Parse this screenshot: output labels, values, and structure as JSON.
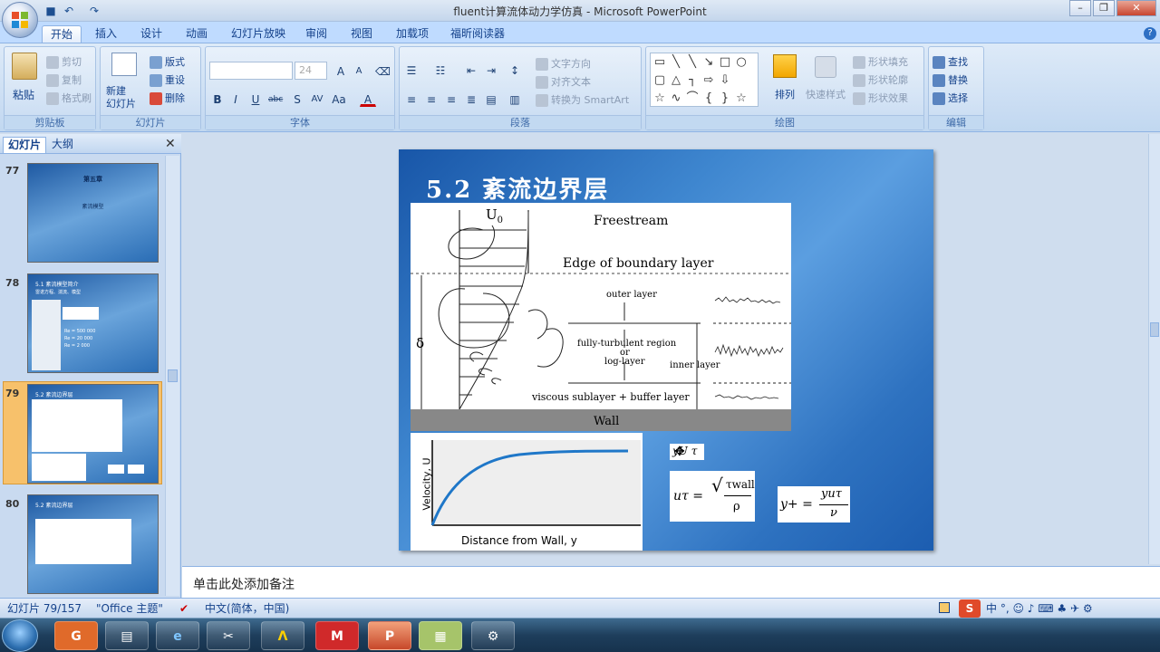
{
  "window": {
    "title": "fluent计算流体动力学仿真 - Microsoft PowerPoint"
  },
  "quick_access": [
    "save-icon",
    "undo-icon",
    "redo-icon"
  ],
  "tabs": [
    "开始",
    "插入",
    "设计",
    "动画",
    "幻灯片放映",
    "审阅",
    "视图",
    "加载项",
    "福昕阅读器"
  ],
  "ribbon": {
    "clipboard": {
      "paste": "粘贴",
      "cut": "剪切",
      "copy": "复制",
      "format_painter": "格式刷",
      "label": "剪贴板"
    },
    "slides": {
      "new_slide": "新建\n幻灯片",
      "layout": "版式",
      "reset": "重设",
      "delete": "删除",
      "label": "幻灯片"
    },
    "font": {
      "size": "24",
      "label": "字体"
    },
    "paragraph": {
      "text_direction": "文字方向",
      "align_text": "对齐文本",
      "convert_smartart": "转换为 SmartArt",
      "label": "段落"
    },
    "drawing": {
      "arrange": "排列",
      "quick_styles": "快速样式",
      "shape_fill": "形状填充",
      "shape_outline": "形状轮廓",
      "shape_effects": "形状效果",
      "label": "绘图"
    },
    "editing": {
      "find": "查找",
      "replace": "替换",
      "select": "选择",
      "label": "编辑"
    }
  },
  "pane_tabs": {
    "slides": "幻灯片",
    "outline": "大纲"
  },
  "thumbnails": [
    {
      "num": "77",
      "title": "第五章",
      "subtitle": "紊流模型"
    },
    {
      "num": "78",
      "title": "5.1 紊流模型简介",
      "line1": "雷诺方程、湍流、模型",
      "re1": "Re = 500 000",
      "re2": "Re = 20 000",
      "re3": "Re = 2 000"
    },
    {
      "num": "79",
      "title": "5.2 紊流边界层"
    },
    {
      "num": "80",
      "title": "5.2 紊流边界层"
    }
  ],
  "slide": {
    "title": "5.2 紊流边界层",
    "bl": {
      "u0": "U",
      "u0_sub": "0",
      "freestream": "Freestream",
      "edge": "Edge of boundary layer",
      "outer": "outer layer",
      "fully": "fully-turbulent region",
      "or": "or",
      "log": "log-layer",
      "inner": "inner layer",
      "viscous": "viscous sublayer + buffer layer",
      "wall": "Wall",
      "delta": "δ"
    },
    "vel": {
      "ylabel": "Velocity, U",
      "xlabel": "Distance from Wall, y"
    },
    "eq1": "yU τ",
    "eq2_lhs": "uτ =",
    "eq2_num": "τwall",
    "eq2_den": "ρ",
    "eq3_lhs": "y+ =",
    "eq3_num": "yuτ",
    "eq3_den": "ν"
  },
  "notes": "单击此处添加备注",
  "status": {
    "slide_count": "幻灯片 79/157",
    "theme": "\"Office 主题\"",
    "language": "中文(简体，中国)"
  },
  "colors": {
    "ribbon": "#c7dbf2",
    "slide_bg": "#3e86cf",
    "selection": "#f7c16b"
  }
}
